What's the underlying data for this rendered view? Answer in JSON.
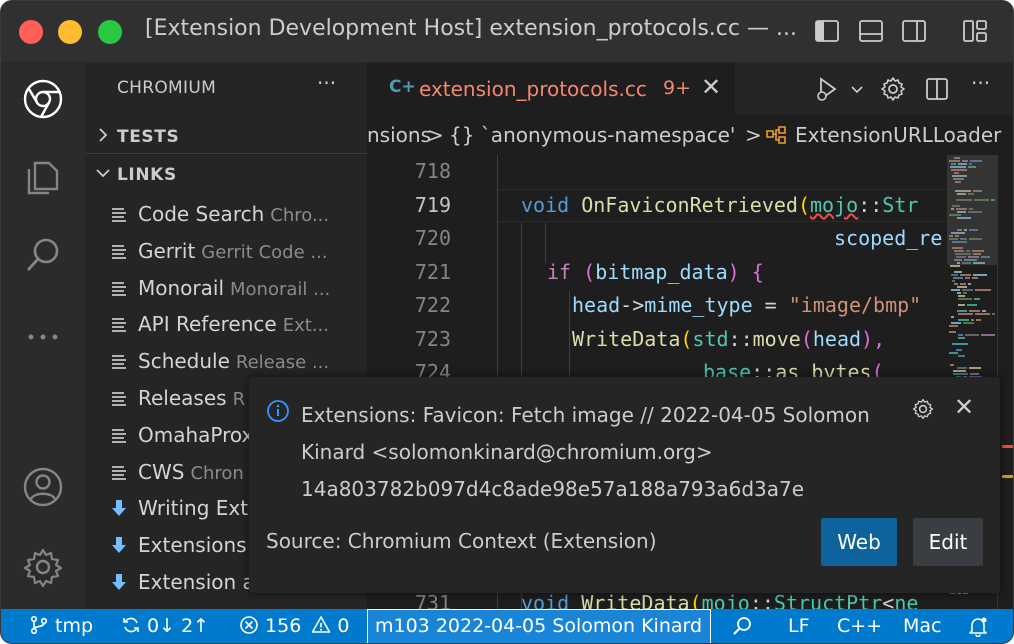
{
  "window": {
    "title": "[Extension Development Host] extension_protocols.cc — ..."
  },
  "sidebar": {
    "title": "CHROMIUM",
    "more": "···",
    "sections": [
      {
        "label": "TESTS",
        "expanded": false
      },
      {
        "label": "LINKS",
        "expanded": true
      }
    ],
    "links": [
      {
        "name": "Code Search",
        "desc": "Chro...",
        "icon": "document-icon"
      },
      {
        "name": "Gerrit",
        "desc": "Gerrit Code ...",
        "icon": "document-icon"
      },
      {
        "name": "Monorail",
        "desc": "Monorail ...",
        "icon": "document-icon"
      },
      {
        "name": "API Reference",
        "desc": "Ext...",
        "icon": "document-icon"
      },
      {
        "name": "Schedule",
        "desc": "Release ...",
        "icon": "document-icon"
      },
      {
        "name": "Releases",
        "desc": "R",
        "icon": "document-icon"
      },
      {
        "name": "OmahaProx",
        "desc": "",
        "icon": "document-icon"
      },
      {
        "name": "CWS",
        "desc": "Chron",
        "icon": "document-icon"
      },
      {
        "name": "Writing Exte",
        "desc": "",
        "icon": "download-icon"
      },
      {
        "name": "Extensions",
        "desc": "",
        "icon": "download-icon"
      },
      {
        "name": "Extension a",
        "desc": "",
        "icon": "download-icon"
      }
    ]
  },
  "tab": {
    "lang": "C+",
    "filename": "extension_protocols.cc",
    "problems": "9+",
    "close": "✕"
  },
  "breadcrumbs": {
    "part1": "nsions",
    "sep": ">",
    "part2": "{} `anonymous-namespace'",
    "part3": "ExtensionURLLoader"
  },
  "code": {
    "lines": [
      {
        "num": "718"
      },
      {
        "num": "719"
      },
      {
        "num": "720"
      },
      {
        "num": "721"
      },
      {
        "num": "722"
      },
      {
        "num": "723"
      },
      {
        "num": "724"
      },
      {
        "num": "731"
      }
    ],
    "tokens": {
      "void": "void",
      "on_favicon": "OnFaviconRetrieved",
      "paren_open": "(",
      "mojo": "mojo",
      "scope": "::",
      "str_frag": "Str",
      "scoped_re": "scoped_re",
      "if": "if",
      "bitmap_data": "bitmap_data",
      "brace": "{",
      "head": "head",
      "arrow": "->",
      "mime_type": "mime_type",
      "eq": " = ",
      "image_bmp": "\"image/bmp\"",
      "write_data": "WriteData",
      "std": "std",
      "move": "move",
      "head_close": "),",
      "base": "base",
      "as_bytes": "as_bytes",
      "paren2": "(",
      "struct_ptr": "StructPtr",
      "lt": "<",
      "ne": "ne"
    }
  },
  "notification": {
    "message": "Extensions: Favicon: Fetch image // 2022-04-05 Solomon Kinard <solomonkinard@chromium.org> 14a803782b097d4c8ade98e57a188a793a6d3a7e",
    "source": "Source: Chromium Context (Extension)",
    "web_label": "Web",
    "edit_label": "Edit",
    "close": "✕"
  },
  "status": {
    "branch": "tmp",
    "sync": "0↓ 2↑",
    "errors": "156",
    "warnings": "0",
    "blame": "m103 2022-04-05 Solomon Kinard",
    "eol": "LF",
    "language": "C++",
    "platform": "Mac"
  },
  "colors": {
    "accent": "#007acc",
    "error": "#f48771",
    "button": "#0e639c"
  }
}
